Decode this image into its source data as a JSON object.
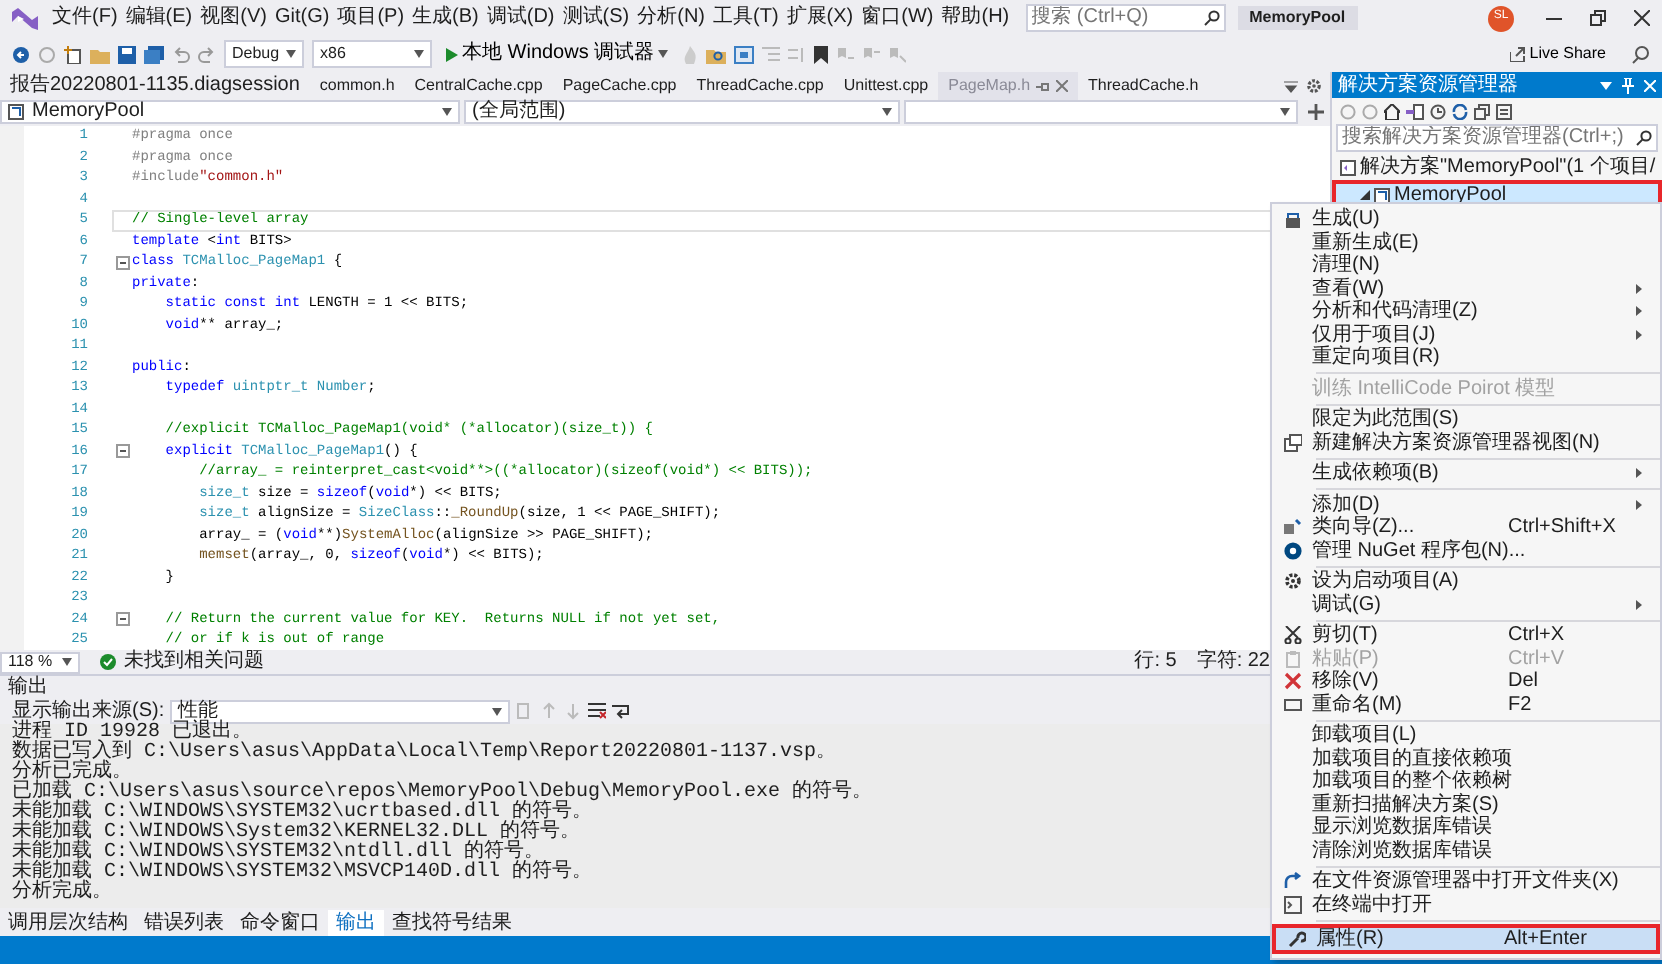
{
  "menu_bar": {
    "items": [
      "文件(F)",
      "编辑(E)",
      "视图(V)",
      "Git(G)",
      "项目(P)",
      "生成(B)",
      "调试(D)",
      "测试(S)",
      "分析(N)",
      "工具(T)",
      "扩展(X)",
      "窗口(W)",
      "帮助(H)"
    ],
    "search": {
      "placeholder": "搜索 (Ctrl+Q)"
    },
    "solution_name": "MemoryPool",
    "avatar": "SL"
  },
  "toolbar": {
    "configuration": "Debug",
    "platform": "x86",
    "run_button": "本地 Windows 调试器",
    "live_share": "Live Share"
  },
  "tabs": [
    {
      "label": "报告20220801-1135.diagsession",
      "selected": false
    },
    {
      "label": "common.h",
      "selected": false
    },
    {
      "label": "CentralCache.cpp",
      "selected": false
    },
    {
      "label": "PageCache.cpp",
      "selected": false
    },
    {
      "label": "ThreadCache.cpp",
      "selected": false
    },
    {
      "label": "Unittest.cpp",
      "selected": false
    },
    {
      "label": "PageMap.h",
      "selected": true
    },
    {
      "label": "ThreadCache.h",
      "selected": false
    }
  ],
  "nav_bar": {
    "project": "MemoryPool",
    "scope": "(全局范围)"
  },
  "editor": {
    "lines": [
      {
        "number": "1",
        "current": false,
        "collapsible": false,
        "segments": [
          {
            "kind": "pre",
            "s": "#pragma once"
          }
        ]
      },
      {
        "number": "2",
        "current": false,
        "collapsible": false,
        "segments": [
          {
            "kind": "pre",
            "s": "#pragma once"
          }
        ]
      },
      {
        "number": "3",
        "current": false,
        "collapsible": false,
        "segments": [
          {
            "kind": "pre",
            "s": "#include"
          },
          {
            "kind": "str",
            "s": "\"common.h\""
          }
        ]
      },
      {
        "number": "4",
        "current": false,
        "collapsible": false
      },
      {
        "number": "5",
        "current": true,
        "collapsible": false,
        "segments": [
          {
            "kind": "cmt",
            "s": "// Single-level array"
          }
        ]
      },
      {
        "number": "6",
        "current": false,
        "collapsible": false,
        "segments": [
          {
            "kind": "kw",
            "s": "template"
          },
          {
            "kind": "p",
            "s": " <"
          },
          {
            "kind": "kw",
            "s": "int"
          },
          {
            "kind": "p",
            "s": " BITS>"
          }
        ]
      },
      {
        "number": "7",
        "current": false,
        "collapsible": true,
        "segments": [
          {
            "kind": "kw",
            "s": "class"
          },
          {
            "kind": "type",
            "s": " TCMalloc_PageMap1"
          },
          {
            "kind": "p",
            "s": " {"
          }
        ]
      },
      {
        "number": "8",
        "current": false,
        "collapsible": false,
        "segments": [
          {
            "kind": "kw",
            "s": "private"
          },
          {
            "kind": "p",
            "s": ":"
          }
        ]
      },
      {
        "number": "9",
        "current": false,
        "collapsible": false,
        "segments": [
          {
            "kind": "kw",
            "s": "    static const int"
          },
          {
            "kind": "p",
            "s": " LENGTH = 1 << BITS;"
          }
        ]
      },
      {
        "number": "10",
        "current": false,
        "collapsible": false,
        "segments": [
          {
            "kind": "kw",
            "s": "    void"
          },
          {
            "kind": "p",
            "s": "** array_;"
          }
        ]
      },
      {
        "number": "11",
        "current": false,
        "collapsible": false
      },
      {
        "number": "12",
        "current": false,
        "collapsible": false,
        "segments": [
          {
            "kind": "kw",
            "s": "public"
          },
          {
            "kind": "p",
            "s": ":"
          }
        ]
      },
      {
        "number": "13",
        "current": false,
        "collapsible": false,
        "segments": [
          {
            "kind": "kw",
            "s": "    typedef"
          },
          {
            "kind": "type",
            "s": " uintptr_t Number"
          },
          {
            "kind": "p",
            "s": ";"
          }
        ]
      },
      {
        "number": "14",
        "current": false,
        "collapsible": false
      },
      {
        "number": "15",
        "current": false,
        "collapsible": false,
        "segments": [
          {
            "kind": "cmt",
            "s": "    //explicit TCMalloc_PageMap1(void* (*allocator)(size_t)) {"
          }
        ]
      },
      {
        "number": "16",
        "current": false,
        "collapsible": true,
        "segments": [
          {
            "kind": "kw",
            "s": "    explicit"
          },
          {
            "kind": "type",
            "s": " TCMalloc_PageMap1"
          },
          {
            "kind": "p",
            "s": "() {"
          }
        ]
      },
      {
        "number": "17",
        "current": false,
        "collapsible": false,
        "segments": [
          {
            "kind": "cmt",
            "s": "        //array_ = reinterpret_cast<void**>((*allocator)(sizeof(void*) << BITS));"
          }
        ]
      },
      {
        "number": "18",
        "current": false,
        "collapsible": false,
        "segments": [
          {
            "kind": "type",
            "s": "        size_t"
          },
          {
            "kind": "p",
            "s": " size = "
          },
          {
            "kind": "kw",
            "s": "sizeof"
          },
          {
            "kind": "p",
            "s": "("
          },
          {
            "kind": "kw",
            "s": "void"
          },
          {
            "kind": "p",
            "s": "*) << BITS;"
          }
        ]
      },
      {
        "number": "19",
        "current": false,
        "collapsible": false,
        "segments": [
          {
            "kind": "type",
            "s": "        size_t"
          },
          {
            "kind": "p",
            "s": " alignSize = "
          },
          {
            "kind": "type",
            "s": "SizeClass"
          },
          {
            "kind": "p",
            "s": "::"
          },
          {
            "kind": "fn",
            "s": "_RoundUp"
          },
          {
            "kind": "p",
            "s": "(size, 1 << PAGE_SHIFT);"
          }
        ]
      },
      {
        "number": "20",
        "current": false,
        "collapsible": false,
        "segments": [
          {
            "kind": "p",
            "s": "        array_ = ("
          },
          {
            "kind": "kw",
            "s": "void"
          },
          {
            "kind": "p",
            "s": "**)"
          },
          {
            "kind": "fn",
            "s": "SystemAlloc"
          },
          {
            "kind": "p",
            "s": "(alignSize >> PAGE_SHIFT);"
          }
        ]
      },
      {
        "number": "21",
        "current": false,
        "collapsible": false,
        "segments": [
          {
            "kind": "fn",
            "s": "        memset"
          },
          {
            "kind": "p",
            "s": "(array_, 0, "
          },
          {
            "kind": "kw",
            "s": "sizeof"
          },
          {
            "kind": "p",
            "s": "("
          },
          {
            "kind": "kw",
            "s": "void"
          },
          {
            "kind": "p",
            "s": "*) << BITS);"
          }
        ]
      },
      {
        "number": "22",
        "current": false,
        "collapsible": false,
        "segments": [
          {
            "kind": "p",
            "s": "    }"
          }
        ]
      },
      {
        "number": "23",
        "current": false,
        "collapsible": false
      },
      {
        "number": "24",
        "current": false,
        "collapsible": true,
        "segments": [
          {
            "kind": "cmt",
            "s": "    // Return the current value for KEY.  Returns NULL if not yet set,"
          }
        ]
      },
      {
        "number": "25",
        "current": false,
        "collapsible": false,
        "segments": [
          {
            "kind": "cmt",
            "s": "    // or if k is out of range"
          }
        ]
      }
    ]
  },
  "editor_status": {
    "zoom": "118 %",
    "issues": "未找到相关问题",
    "line": "行: 5",
    "column": "字符: 22"
  },
  "output": {
    "title": "输出",
    "source_label": "显示输出来源(S):",
    "source": "性能",
    "lines": [
      "进程 ID 19928 已退出。",
      "数据已写入到 C:\\Users\\asus\\AppData\\Local\\Temp\\Report20220801-1137.vsp。",
      "分析已完成。",
      "已加载 C:\\Users\\asus\\source\\repos\\MemoryPool\\Debug\\MemoryPool.exe 的符号。",
      "未能加载 C:\\WINDOWS\\SYSTEM32\\ucrtbased.dll 的符号。",
      "未能加载 C:\\WINDOWS\\System32\\KERNEL32.DLL 的符号。",
      "未能加载 C:\\WINDOWS\\SYSTEM32\\ntdll.dll 的符号。",
      "未能加载 C:\\WINDOWS\\SYSTEM32\\MSVCP140D.dll 的符号。",
      "分析完成。"
    ],
    "tabs": [
      {
        "label": "调用层次结构",
        "selected": false
      },
      {
        "label": "错误列表",
        "selected": false
      },
      {
        "label": "命令窗口",
        "selected": false
      },
      {
        "label": "输出",
        "selected": true
      },
      {
        "label": "查找符号结果",
        "selected": false
      }
    ]
  },
  "solution_explorer": {
    "title": "解决方案资源管理器",
    "search": {
      "placeholder": "搜索解决方案资源管理器(Ctrl+;)"
    },
    "tree": [
      {
        "label": "解决方案\"MemoryPool\"(1 个项目/",
        "selected": false,
        "outlined": false,
        "children": [
          {
            "label": "MemoryPool",
            "selected": true,
            "outlined": true,
            "expanded": true
          }
        ]
      }
    ]
  },
  "context_menu": [
    {
      "kind": "item",
      "label": "生成(U)",
      "submenu": false,
      "disabled": false,
      "highlighted": false,
      "outlined": false
    },
    {
      "kind": "item",
      "label": "重新生成(E)",
      "submenu": false,
      "disabled": false,
      "highlighted": false,
      "outlined": false
    },
    {
      "kind": "item",
      "label": "清理(N)",
      "submenu": false,
      "disabled": false,
      "highlighted": false,
      "outlined": false
    },
    {
      "kind": "item",
      "label": "查看(W)",
      "submenu": true,
      "disabled": false,
      "highlighted": false,
      "outlined": false
    },
    {
      "kind": "item",
      "label": "分析和代码清理(Z)",
      "submenu": true,
      "disabled": false,
      "highlighted": false,
      "outlined": false
    },
    {
      "kind": "item",
      "label": "仅用于项目(J)",
      "submenu": true,
      "disabled": false,
      "highlighted": false,
      "outlined": false
    },
    {
      "kind": "item",
      "label": "重定向项目(R)",
      "submenu": false,
      "disabled": false,
      "highlighted": false,
      "outlined": false
    },
    {
      "kind": "separator"
    },
    {
      "kind": "item",
      "label": "训练 IntelliCode Poirot 模型",
      "submenu": false,
      "disabled": true,
      "highlighted": false,
      "outlined": false
    },
    {
      "kind": "separator"
    },
    {
      "kind": "item",
      "label": "限定为此范围(S)",
      "submenu": false,
      "disabled": false,
      "highlighted": false,
      "outlined": false
    },
    {
      "kind": "item",
      "label": "新建解决方案资源管理器视图(N)",
      "submenu": false,
      "disabled": false,
      "highlighted": false,
      "outlined": false
    },
    {
      "kind": "separator"
    },
    {
      "kind": "item",
      "label": "生成依赖项(B)",
      "submenu": true,
      "disabled": false,
      "highlighted": false,
      "outlined": false
    },
    {
      "kind": "separator"
    },
    {
      "kind": "item",
      "label": "添加(D)",
      "submenu": true,
      "disabled": false,
      "highlighted": false,
      "outlined": false
    },
    {
      "kind": "item",
      "label": "类向导(Z)...",
      "shortcut": "Ctrl+Shift+X",
      "submenu": false,
      "disabled": false,
      "highlighted": false,
      "outlined": false
    },
    {
      "kind": "item",
      "label": "管理 NuGet 程序包(N)...",
      "submenu": false,
      "disabled": false,
      "highlighted": false,
      "outlined": false
    },
    {
      "kind": "separator"
    },
    {
      "kind": "item",
      "label": "设为启动项目(A)",
      "submenu": false,
      "disabled": false,
      "highlighted": false,
      "outlined": false
    },
    {
      "kind": "item",
      "label": "调试(G)",
      "submenu": true,
      "disabled": false,
      "highlighted": false,
      "outlined": false
    },
    {
      "kind": "separator"
    },
    {
      "kind": "item",
      "label": "剪切(T)",
      "shortcut": "Ctrl+X",
      "submenu": false,
      "disabled": false,
      "highlighted": false,
      "outlined": false
    },
    {
      "kind": "item",
      "label": "粘贴(P)",
      "shortcut": "Ctrl+V",
      "submenu": false,
      "disabled": true,
      "highlighted": false,
      "outlined": false
    },
    {
      "kind": "item",
      "label": "移除(V)",
      "shortcut": "Del",
      "submenu": false,
      "disabled": false,
      "highlighted": false,
      "outlined": false
    },
    {
      "kind": "item",
      "label": "重命名(M)",
      "shortcut": "F2",
      "submenu": false,
      "disabled": false,
      "highlighted": false,
      "outlined": false
    },
    {
      "kind": "separator"
    },
    {
      "kind": "item",
      "label": "卸载项目(L)",
      "submenu": false,
      "disabled": false,
      "highlighted": false,
      "outlined": false
    },
    {
      "kind": "item",
      "label": "加载项目的直接依赖项",
      "submenu": false,
      "disabled": false,
      "highlighted": false,
      "outlined": false
    },
    {
      "kind": "item",
      "label": "加载项目的整个依赖树",
      "submenu": false,
      "disabled": false,
      "highlighted": false,
      "outlined": false
    },
    {
      "kind": "item",
      "label": "重新扫描解决方案(S)",
      "submenu": false,
      "disabled": false,
      "highlighted": false,
      "outlined": false
    },
    {
      "kind": "item",
      "label": "显示浏览数据库错误",
      "submenu": false,
      "disabled": false,
      "highlighted": false,
      "outlined": false
    },
    {
      "kind": "item",
      "label": "清除浏览数据库错误",
      "submenu": false,
      "disabled": false,
      "highlighted": false,
      "outlined": false
    },
    {
      "kind": "separator"
    },
    {
      "kind": "item",
      "label": "在文件资源管理器中打开文件夹(X)",
      "submenu": false,
      "disabled": false,
      "highlighted": false,
      "outlined": false
    },
    {
      "kind": "item",
      "label": "在终端中打开",
      "submenu": false,
      "disabled": false,
      "highlighted": false,
      "outlined": false
    },
    {
      "kind": "separator"
    },
    {
      "kind": "item",
      "label": "属性(R)",
      "shortcut": "Alt+Enter",
      "submenu": false,
      "disabled": false,
      "highlighted": true,
      "outlined": true
    }
  ]
}
